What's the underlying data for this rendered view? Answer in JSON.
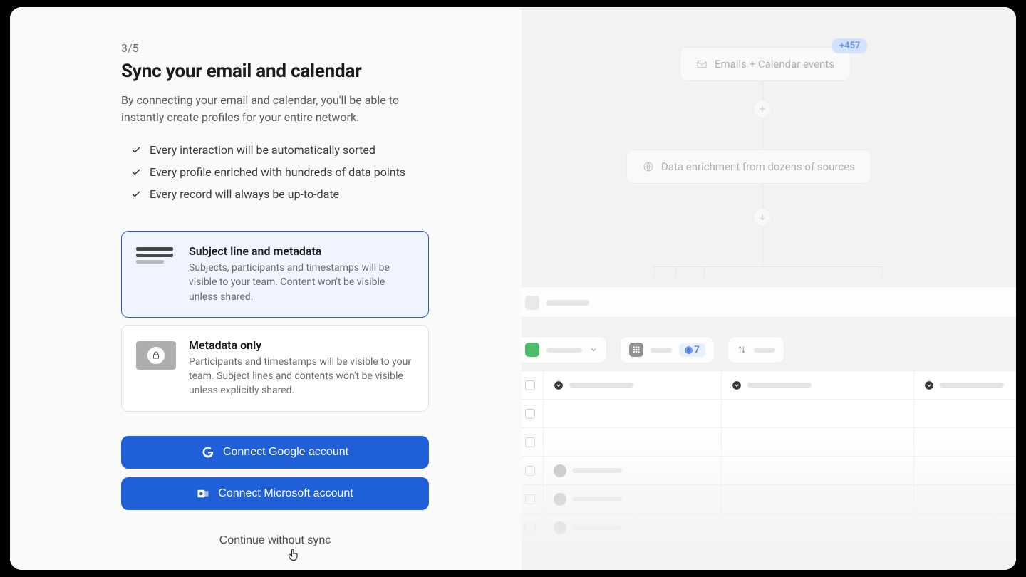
{
  "step": "3/5",
  "headline": "Sync your email and calendar",
  "subtext": "By connecting your email and calendar, you'll be able to instantly create profiles for your entire network.",
  "checklist": [
    "Every interaction will be automatically sorted",
    "Every profile enriched with hundreds of data points",
    "Every record will always be up-to-date"
  ],
  "options": [
    {
      "title": "Subject line and metadata",
      "desc": "Subjects, participants and timestamps will be visible to your team. Content won't be visible unless shared.",
      "selected": true
    },
    {
      "title": "Metadata only",
      "desc": "Participants and timestamps will be visible to your team. Subject lines and contents won't be visible unless explicitly shared.",
      "selected": false
    }
  ],
  "buttons": {
    "google": "Connect Google account",
    "microsoft": "Connect Microsoft account",
    "skip": "Continue without sync"
  },
  "right_panel": {
    "pill_emails": "Emails + Calendar events",
    "badge_count": "+457",
    "pill_enrichment": "Data enrichment from dozens of sources",
    "view_count": "7"
  }
}
